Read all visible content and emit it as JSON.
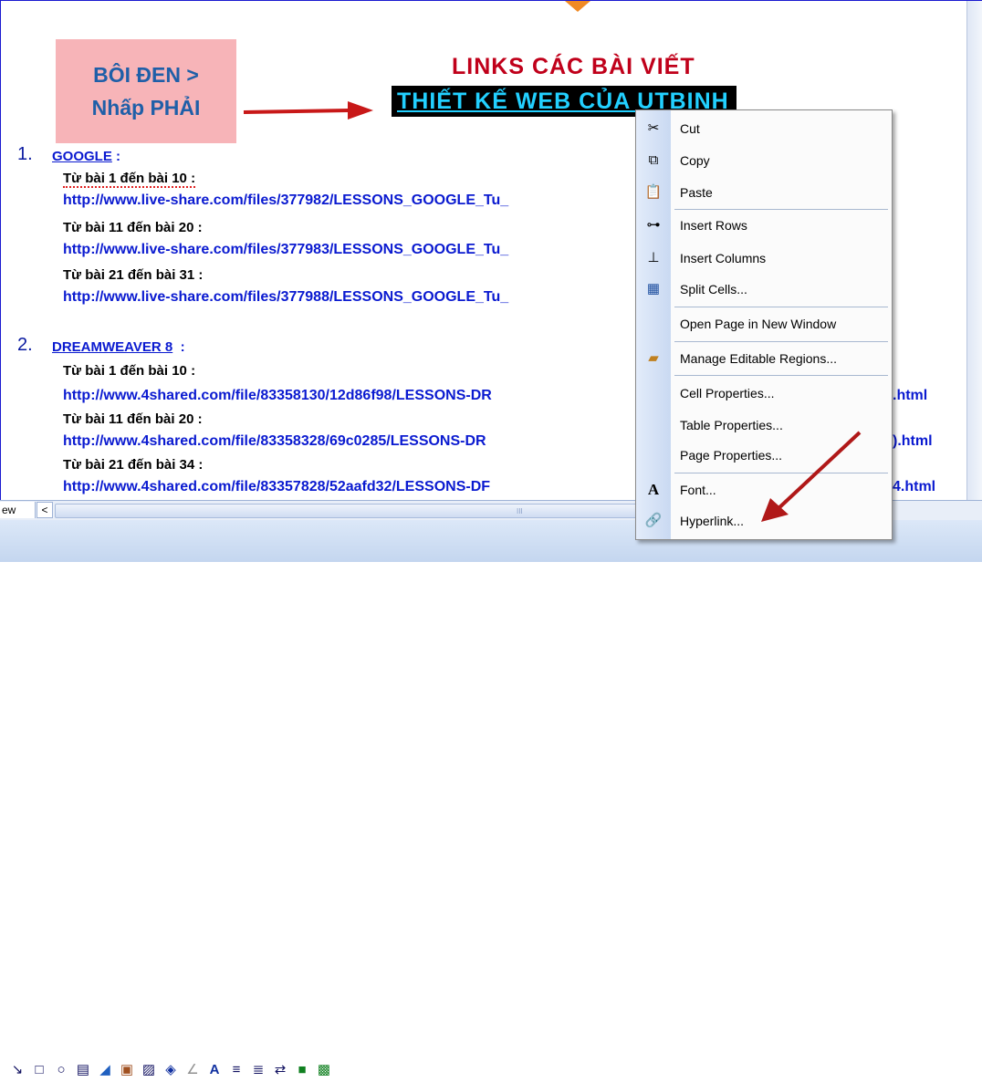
{
  "callout": {
    "line1": "BÔI ĐEN >",
    "line2": "Nhấp PHẢI"
  },
  "title": {
    "line1": "LINKS CÁC BÀI VIẾT",
    "line2": "THIẾT KẾ WEB CỦA UTBINH"
  },
  "sections": [
    {
      "number": "1.",
      "name": "GOOGLE",
      "suffix": " :",
      "entries": [
        {
          "label": "Từ bài 1 đến bài 10 :",
          "url": "http://www.live-share.com/files/377982/LESSONS_GOOGLE_Tu_"
        },
        {
          "label": "Từ bài 11 đến bài 20 :",
          "url": "http://www.live-share.com/files/377983/LESSONS_GOOGLE_Tu_"
        },
        {
          "label": "Từ bài 21 đến bài 31 :",
          "url": "http://www.live-share.com/files/377988/LESSONS_GOOGLE_Tu_"
        }
      ]
    },
    {
      "number": "2.",
      "name": "DREAMWEAVER 8",
      "suffix": "  :",
      "entries": [
        {
          "label": "Từ bài 1 đến bài 10 :",
          "url": "http://www.4shared.com/file/83358130/12d86f98/LESSONS-DR",
          "tail": ".html"
        },
        {
          "label": "Từ bài 11 đến bài 20 :",
          "url": "http://www.4shared.com/file/83358328/69c0285/LESSONS-DR",
          "tail": ").html"
        },
        {
          "label": "Từ bài 21 đến bài 34 :",
          "url": "http://www.4shared.com/file/83357828/52aafd32/LESSONS-DF",
          "tail": "4.html"
        }
      ]
    }
  ],
  "statusbar": {
    "view_tab": "ew",
    "left_arrow": "<",
    "grip": "III"
  },
  "context_menu": {
    "items": [
      {
        "label": "Cut",
        "icon": "scissors-icon"
      },
      {
        "label": "Copy",
        "icon": "copy-icon"
      },
      {
        "label": "Paste",
        "icon": "paste-icon"
      },
      {
        "label": "Insert Rows",
        "icon": "insert-rows-icon"
      },
      {
        "label": "Insert Columns",
        "icon": "insert-columns-icon"
      },
      {
        "label": "Split Cells...",
        "icon": "split-cells-icon"
      },
      {
        "label": "Open Page in New Window",
        "icon": ""
      },
      {
        "label": "Manage Editable Regions...",
        "icon": "editable-regions-icon"
      },
      {
        "label": "Cell Properties...",
        "icon": ""
      },
      {
        "label": "Table Properties...",
        "icon": ""
      },
      {
        "label": "Page Properties...",
        "icon": ""
      },
      {
        "label": "Font...",
        "icon": "font-icon"
      },
      {
        "label": "Hyperlink...",
        "icon": "hyperlink-icon"
      }
    ]
  },
  "colors": {
    "link": "#0a1ad0",
    "title_red": "#c0001a",
    "highlight_text": "#22d0ff",
    "callout_bg": "#f7b4b8"
  }
}
